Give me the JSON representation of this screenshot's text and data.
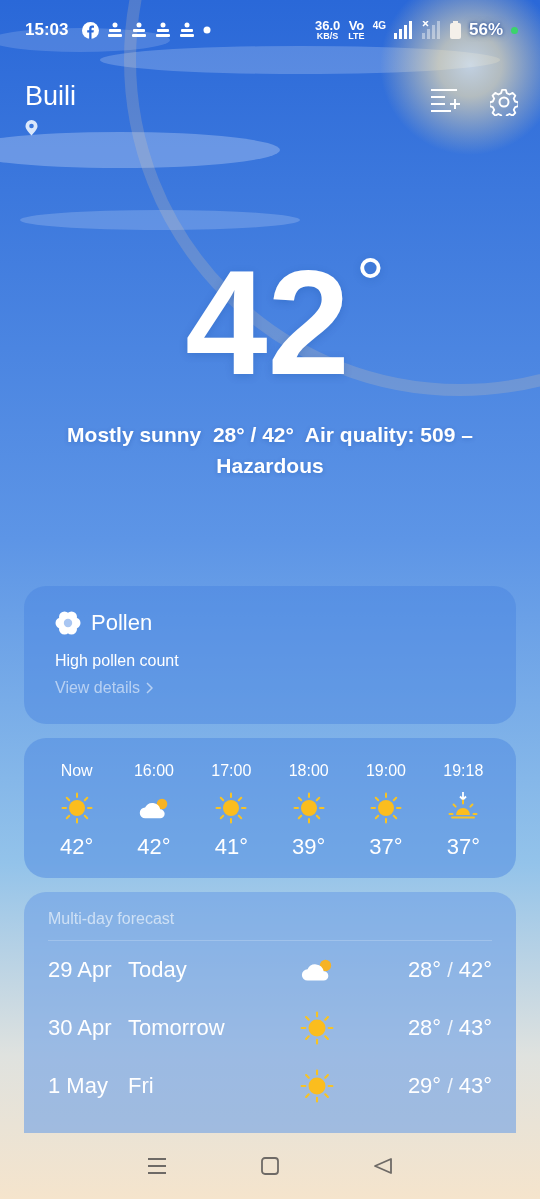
{
  "status_bar": {
    "time": "15:03",
    "speed": "36.0",
    "speed_unit": "KB/S",
    "volte_top": "Vo",
    "volte_bottom": "LTE",
    "network": "4G",
    "battery": "56%"
  },
  "header": {
    "city": "Buili"
  },
  "current": {
    "temperature": "42",
    "degree": "°",
    "summary": "Mostly sunny  28° / 42°  Air quality: 509 – Hazardous"
  },
  "pollen": {
    "title": "Pollen",
    "description": "High pollen count",
    "link": "View details"
  },
  "hourly": [
    {
      "time": "Now",
      "kind": "sun",
      "temp": "42°"
    },
    {
      "time": "16:00",
      "kind": "partly_cloudy",
      "temp": "42°"
    },
    {
      "time": "17:00",
      "kind": "sun",
      "temp": "41°"
    },
    {
      "time": "18:00",
      "kind": "sun",
      "temp": "39°"
    },
    {
      "time": "19:00",
      "kind": "sun",
      "temp": "37°"
    },
    {
      "time": "19:18",
      "kind": "sunset",
      "temp": "37°"
    }
  ],
  "daily": {
    "title": "Multi-day forecast",
    "days": [
      {
        "date": "29 Apr",
        "label": "Today",
        "kind": "partly_cloudy",
        "low": "28°",
        "separator": "/",
        "high": "42°"
      },
      {
        "date": "30 Apr",
        "label": "Tomorrow",
        "kind": "sun",
        "low": "28°",
        "separator": "/",
        "high": "43°"
      },
      {
        "date": "1 May",
        "label": "Fri",
        "kind": "sun",
        "low": "29°",
        "separator": "/",
        "high": "43°"
      }
    ]
  }
}
